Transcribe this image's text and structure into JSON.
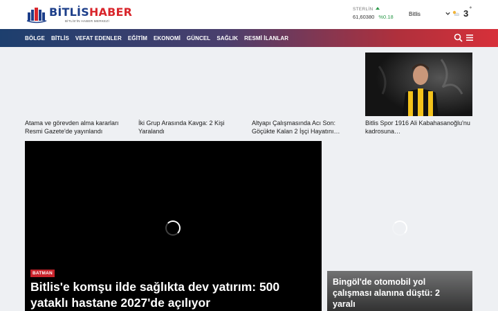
{
  "header": {
    "logo": {
      "text_a": "BİTLİS",
      "text_b": "HABER",
      "subtitle": "BİTLİS'İN HABER MERKEZİ"
    },
    "currency": {
      "label": "STERLİN",
      "value": "61,60380",
      "change": "%0.18",
      "trend_color": "#2b9a4a"
    },
    "city": "Bitlis",
    "weather": {
      "temperature": "3",
      "degree": "°",
      "icon": "partly-cloudy-icon"
    }
  },
  "nav": {
    "items": [
      "BÖLGE",
      "BİTLİS",
      "VEFAT EDENLER",
      "EĞİTİM",
      "EKONOMİ",
      "GÜNCEL",
      "SAĞLIK",
      "RESMİ İLANLAR"
    ],
    "search_icon": "search-icon",
    "menu_icon": "hamburger-menu-icon"
  },
  "top_news": [
    {
      "title": "Atama ve görevden alma kararları Resmi Gazete'de yayınlandı"
    },
    {
      "title": "İki Grup Arasında Kavga: 2 Kişi Yaralandı"
    },
    {
      "title": "Altyapı Çalışmasında Acı Son: Göçükte Kalan 2 İşçi Hayatını…"
    },
    {
      "title": "Bitlis Spor 1916 Ali Kabahasanoğlu'nu kadrosuna…"
    }
  ],
  "featured": {
    "category": "BATMAN",
    "title": "Bitlis'e komşu ilde sağlıkta dev yatırım: 500 yataklı hastane 2027'de açılıyor"
  },
  "side_featured": {
    "title": "Bingöl'de otomobil yol çalışması alanına düştü: 2 yaralı"
  },
  "colors": {
    "brand_blue": "#1d3f8a",
    "brand_red": "#d9262c",
    "badge_red": "#c8232b"
  }
}
